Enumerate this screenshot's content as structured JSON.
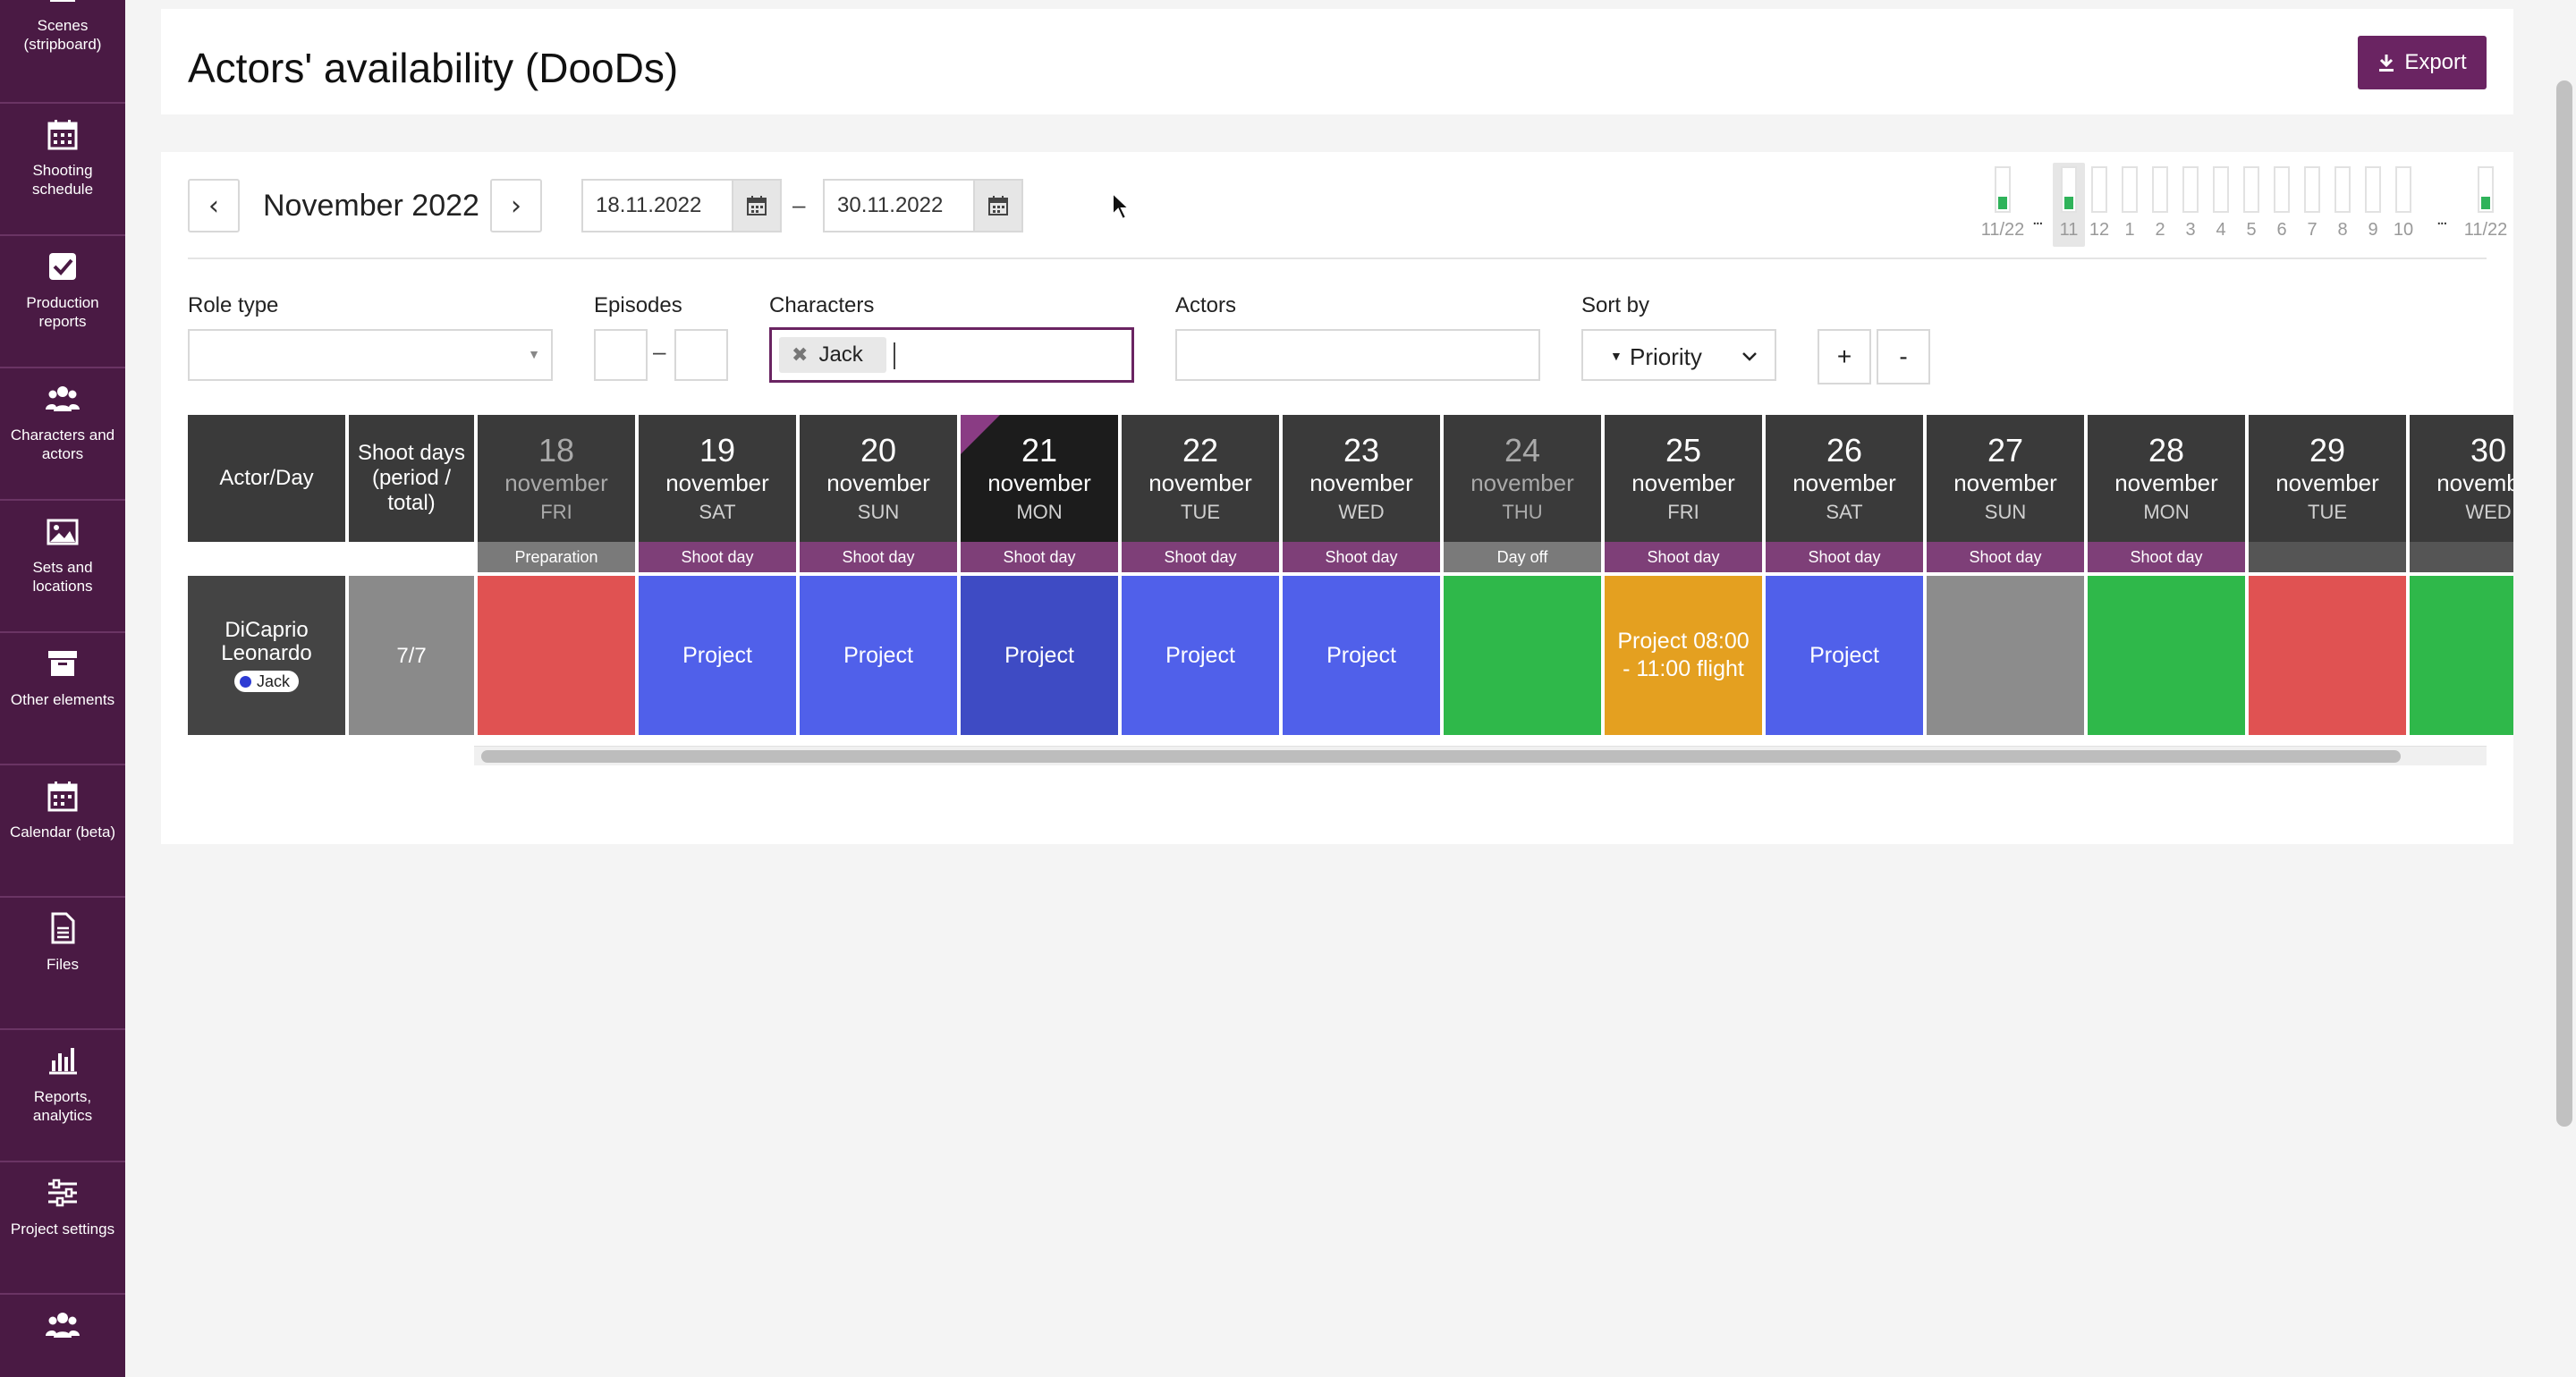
{
  "sidebar": {
    "items": [
      {
        "label": "Scenes (stripboard)",
        "icon": "clapperboard-icon"
      },
      {
        "label": "Shooting schedule",
        "icon": "calendar-grid-icon"
      },
      {
        "label": "Production reports",
        "icon": "check-square-icon"
      },
      {
        "label": "Characters and actors",
        "icon": "users-icon"
      },
      {
        "label": "Sets and locations",
        "icon": "image-icon"
      },
      {
        "label": "Other elements",
        "icon": "archive-icon"
      },
      {
        "label": "Calendar (beta)",
        "icon": "calendar-icon"
      },
      {
        "label": "Files",
        "icon": "file-icon"
      },
      {
        "label": "Reports, analytics",
        "icon": "bar-chart-icon"
      },
      {
        "label": "Project settings",
        "icon": "sliders-icon"
      },
      {
        "label": "",
        "icon": "users-icon"
      }
    ]
  },
  "header": {
    "title": "Actors' availability (DooDs)",
    "export_label": "Export"
  },
  "toolbar": {
    "prev": "‹",
    "next": "›",
    "month": "November 2022",
    "date_from": "18.11.2022",
    "date_to": "30.11.2022",
    "dash": "–"
  },
  "mini_timeline": {
    "labels": [
      "11/22",
      "11",
      "12",
      "1",
      "2",
      "3",
      "4",
      "5",
      "6",
      "7",
      "8",
      "9",
      "10",
      "11/22"
    ],
    "ellipsis": "...",
    "selected": "11",
    "filled": [
      "11/22 start",
      "11",
      "11/22 end"
    ]
  },
  "filters": {
    "role_type_label": "Role type",
    "role_type_value": "",
    "episodes_label": "Episodes",
    "episodes_from": "",
    "episodes_to": "",
    "episodes_dash": "–",
    "characters_label": "Characters",
    "characters_chips": [
      "Jack"
    ],
    "actors_label": "Actors",
    "actors_value": "",
    "sort_label": "Sort by",
    "sort_value": "Priority",
    "zoom_in": "+",
    "zoom_out": "-"
  },
  "grid": {
    "actor_header": "Actor/Day",
    "shoot_header": "Shoot days (period / total)",
    "days": [
      {
        "num": "18",
        "month": "november",
        "wd": "FRI",
        "type": "Preparation",
        "type_color": "#7a7a7a",
        "dim": true
      },
      {
        "num": "19",
        "month": "november",
        "wd": "SAT",
        "type": "Shoot day",
        "type_color": "#7e3f78"
      },
      {
        "num": "20",
        "month": "november",
        "wd": "SUN",
        "type": "Shoot day",
        "type_color": "#7e3f78"
      },
      {
        "num": "21",
        "month": "november",
        "wd": "MON",
        "type": "Shoot day",
        "type_color": "#7e3f78",
        "today": true
      },
      {
        "num": "22",
        "month": "november",
        "wd": "TUE",
        "type": "Shoot day",
        "type_color": "#7e3f78"
      },
      {
        "num": "23",
        "month": "november",
        "wd": "WED",
        "type": "Shoot day",
        "type_color": "#7e3f78"
      },
      {
        "num": "24",
        "month": "november",
        "wd": "THU",
        "type": "Day off",
        "type_color": "#7a7a7a",
        "dim": true
      },
      {
        "num": "25",
        "month": "november",
        "wd": "FRI",
        "type": "Shoot day",
        "type_color": "#7e3f78"
      },
      {
        "num": "26",
        "month": "november",
        "wd": "SAT",
        "type": "Shoot day",
        "type_color": "#7e3f78"
      },
      {
        "num": "27",
        "month": "november",
        "wd": "SUN",
        "type": "Shoot day",
        "type_color": "#7e3f78"
      },
      {
        "num": "28",
        "month": "november",
        "wd": "MON",
        "type": "Shoot day",
        "type_color": "#7e3f78"
      },
      {
        "num": "29",
        "month": "november",
        "wd": "TUE",
        "type": "",
        "type_color": "#555555"
      },
      {
        "num": "30",
        "month": "november",
        "wd": "WED",
        "type": "",
        "type_color": "#555555"
      }
    ],
    "rows": [
      {
        "actor_name": "DiCaprio Leonardo",
        "role": "Jack",
        "shoot_days": "7/7",
        "cells": [
          {
            "text": "",
            "color": "#e05252"
          },
          {
            "text": "Project",
            "color": "#5060ea"
          },
          {
            "text": "Project",
            "color": "#5060ea"
          },
          {
            "text": "Project",
            "color": "#3e4bc4"
          },
          {
            "text": "Project",
            "color": "#5060ea"
          },
          {
            "text": "Project",
            "color": "#5060ea"
          },
          {
            "text": "",
            "color": "#2fb84a"
          },
          {
            "text": "Project 08:00 - 11:00 flight",
            "color": "#e4a020"
          },
          {
            "text": "Project",
            "color": "#5060ea"
          },
          {
            "text": "",
            "color": "#8c8c8c"
          },
          {
            "text": "",
            "color": "#2fb84a"
          },
          {
            "text": "",
            "color": "#e05252"
          },
          {
            "text": "",
            "color": "#2fb84a"
          }
        ]
      }
    ]
  }
}
